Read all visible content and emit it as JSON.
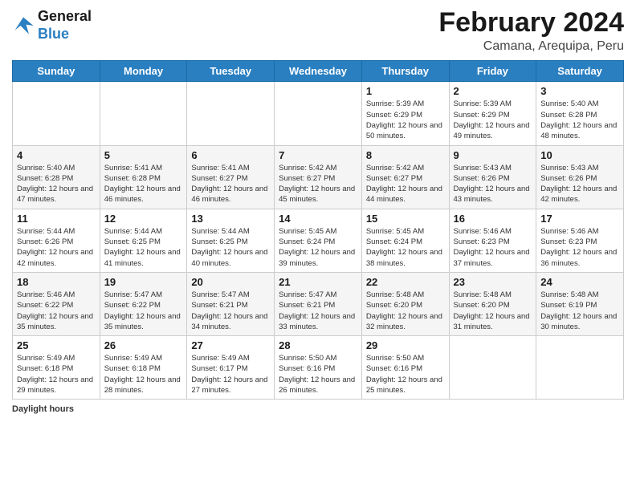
{
  "logo": {
    "text_general": "General",
    "text_blue": "Blue"
  },
  "header": {
    "month_title": "February 2024",
    "location": "Camana, Arequipa, Peru"
  },
  "weekdays": [
    "Sunday",
    "Monday",
    "Tuesday",
    "Wednesday",
    "Thursday",
    "Friday",
    "Saturday"
  ],
  "footer": {
    "label": "Daylight hours"
  },
  "weeks": [
    [
      {
        "day": "",
        "sunrise": "",
        "sunset": "",
        "daylight": ""
      },
      {
        "day": "",
        "sunrise": "",
        "sunset": "",
        "daylight": ""
      },
      {
        "day": "",
        "sunrise": "",
        "sunset": "",
        "daylight": ""
      },
      {
        "day": "",
        "sunrise": "",
        "sunset": "",
        "daylight": ""
      },
      {
        "day": "1",
        "sunrise": "5:39 AM",
        "sunset": "6:29 PM",
        "daylight": "12 hours and 50 minutes."
      },
      {
        "day": "2",
        "sunrise": "5:39 AM",
        "sunset": "6:29 PM",
        "daylight": "12 hours and 49 minutes."
      },
      {
        "day": "3",
        "sunrise": "5:40 AM",
        "sunset": "6:28 PM",
        "daylight": "12 hours and 48 minutes."
      }
    ],
    [
      {
        "day": "4",
        "sunrise": "5:40 AM",
        "sunset": "6:28 PM",
        "daylight": "12 hours and 47 minutes."
      },
      {
        "day": "5",
        "sunrise": "5:41 AM",
        "sunset": "6:28 PM",
        "daylight": "12 hours and 46 minutes."
      },
      {
        "day": "6",
        "sunrise": "5:41 AM",
        "sunset": "6:27 PM",
        "daylight": "12 hours and 46 minutes."
      },
      {
        "day": "7",
        "sunrise": "5:42 AM",
        "sunset": "6:27 PM",
        "daylight": "12 hours and 45 minutes."
      },
      {
        "day": "8",
        "sunrise": "5:42 AM",
        "sunset": "6:27 PM",
        "daylight": "12 hours and 44 minutes."
      },
      {
        "day": "9",
        "sunrise": "5:43 AM",
        "sunset": "6:26 PM",
        "daylight": "12 hours and 43 minutes."
      },
      {
        "day": "10",
        "sunrise": "5:43 AM",
        "sunset": "6:26 PM",
        "daylight": "12 hours and 42 minutes."
      }
    ],
    [
      {
        "day": "11",
        "sunrise": "5:44 AM",
        "sunset": "6:26 PM",
        "daylight": "12 hours and 42 minutes."
      },
      {
        "day": "12",
        "sunrise": "5:44 AM",
        "sunset": "6:25 PM",
        "daylight": "12 hours and 41 minutes."
      },
      {
        "day": "13",
        "sunrise": "5:44 AM",
        "sunset": "6:25 PM",
        "daylight": "12 hours and 40 minutes."
      },
      {
        "day": "14",
        "sunrise": "5:45 AM",
        "sunset": "6:24 PM",
        "daylight": "12 hours and 39 minutes."
      },
      {
        "day": "15",
        "sunrise": "5:45 AM",
        "sunset": "6:24 PM",
        "daylight": "12 hours and 38 minutes."
      },
      {
        "day": "16",
        "sunrise": "5:46 AM",
        "sunset": "6:23 PM",
        "daylight": "12 hours and 37 minutes."
      },
      {
        "day": "17",
        "sunrise": "5:46 AM",
        "sunset": "6:23 PM",
        "daylight": "12 hours and 36 minutes."
      }
    ],
    [
      {
        "day": "18",
        "sunrise": "5:46 AM",
        "sunset": "6:22 PM",
        "daylight": "12 hours and 35 minutes."
      },
      {
        "day": "19",
        "sunrise": "5:47 AM",
        "sunset": "6:22 PM",
        "daylight": "12 hours and 35 minutes."
      },
      {
        "day": "20",
        "sunrise": "5:47 AM",
        "sunset": "6:21 PM",
        "daylight": "12 hours and 34 minutes."
      },
      {
        "day": "21",
        "sunrise": "5:47 AM",
        "sunset": "6:21 PM",
        "daylight": "12 hours and 33 minutes."
      },
      {
        "day": "22",
        "sunrise": "5:48 AM",
        "sunset": "6:20 PM",
        "daylight": "12 hours and 32 minutes."
      },
      {
        "day": "23",
        "sunrise": "5:48 AM",
        "sunset": "6:20 PM",
        "daylight": "12 hours and 31 minutes."
      },
      {
        "day": "24",
        "sunrise": "5:48 AM",
        "sunset": "6:19 PM",
        "daylight": "12 hours and 30 minutes."
      }
    ],
    [
      {
        "day": "25",
        "sunrise": "5:49 AM",
        "sunset": "6:18 PM",
        "daylight": "12 hours and 29 minutes."
      },
      {
        "day": "26",
        "sunrise": "5:49 AM",
        "sunset": "6:18 PM",
        "daylight": "12 hours and 28 minutes."
      },
      {
        "day": "27",
        "sunrise": "5:49 AM",
        "sunset": "6:17 PM",
        "daylight": "12 hours and 27 minutes."
      },
      {
        "day": "28",
        "sunrise": "5:50 AM",
        "sunset": "6:16 PM",
        "daylight": "12 hours and 26 minutes."
      },
      {
        "day": "29",
        "sunrise": "5:50 AM",
        "sunset": "6:16 PM",
        "daylight": "12 hours and 25 minutes."
      },
      {
        "day": "",
        "sunrise": "",
        "sunset": "",
        "daylight": ""
      },
      {
        "day": "",
        "sunrise": "",
        "sunset": "",
        "daylight": ""
      }
    ]
  ]
}
